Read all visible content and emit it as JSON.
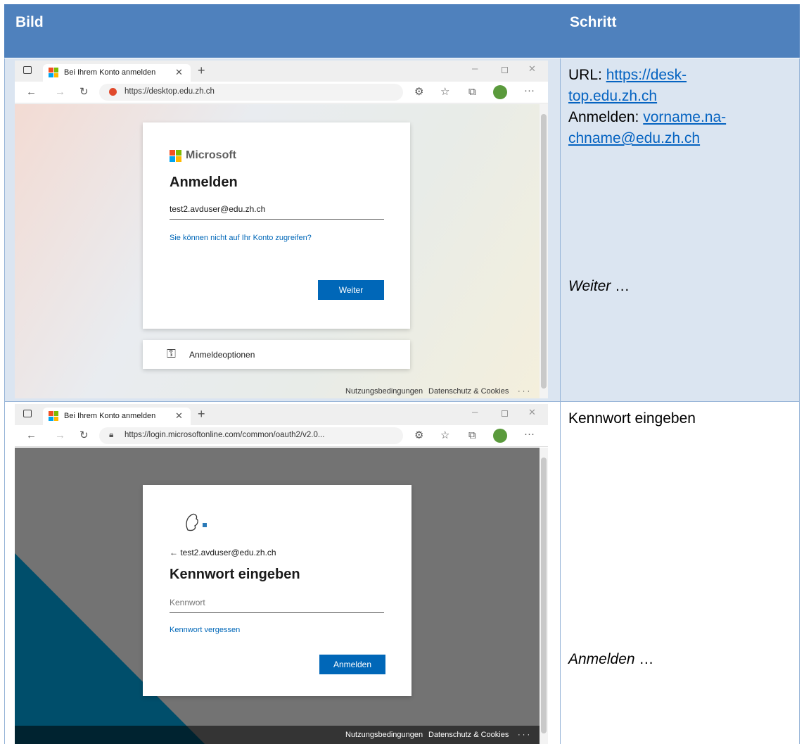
{
  "table": {
    "header": {
      "image_col": "Bild",
      "step_col": "Schritt"
    }
  },
  "row1": {
    "browser": {
      "tab_title": "Bei Ihrem Konto anmelden",
      "url": "https://desktop.edu.zh.ch"
    },
    "signin": {
      "brand": "Microsoft",
      "title": "Anmelden",
      "email_value": "test2.avduser@edu.zh.ch",
      "cant_access_link": "Sie können nicht auf Ihr Konto zugreifen?",
      "next_button": "Weiter",
      "options_label": "Anmeldeoptionen"
    },
    "footer": {
      "terms": "Nutzungsbedingungen",
      "privacy": "Datenschutz & Cookies",
      "more": "· · ·"
    },
    "step": {
      "url_label": "URL: ",
      "url_link_1": "https://desk-",
      "url_link_2": "top.edu.zh.ch",
      "signin_label": "Anmelden: ",
      "signin_link_1": "vorname.na-",
      "signin_link_2": "chname@edu.zh.ch",
      "next_italic": "Weiter",
      "next_suffix": " …"
    }
  },
  "row2": {
    "browser": {
      "tab_title": "Bei Ihrem Konto anmelden",
      "url": "https://login.microsoftonline.com/common/oauth2/v2.0..."
    },
    "signin": {
      "back_email": "← test2.avduser@edu.zh.ch",
      "title": "Kennwort eingeben",
      "password_placeholder": "Kennwort",
      "forgot_link": "Kennwort vergessen",
      "signin_button": "Anmelden"
    },
    "footer": {
      "terms": "Nutzungsbedingungen",
      "privacy": "Datenschutz & Cookies",
      "more": "· · ·"
    },
    "step": {
      "title": "Kennwort eingeben",
      "signin_italic": "Anmelden",
      "signin_suffix": " …"
    }
  },
  "colors": {
    "header_bg": "#4f81bd",
    "row_bg": "#dbe5f1",
    "ms_blue": "#0067b8",
    "teal_shape": "#004e6b"
  },
  "icons": [
    "tab-actions-icon",
    "microsoft-logo-icon",
    "close-icon",
    "new-tab-icon",
    "minimize-icon",
    "maximize-icon",
    "back-icon",
    "forward-icon",
    "refresh-icon",
    "site-blocked-icon",
    "lock-icon",
    "extensions-icon",
    "favorites-icon",
    "collections-icon",
    "profile-icon",
    "more-icon",
    "key-icon",
    "zurich-lion-logo-icon"
  ]
}
